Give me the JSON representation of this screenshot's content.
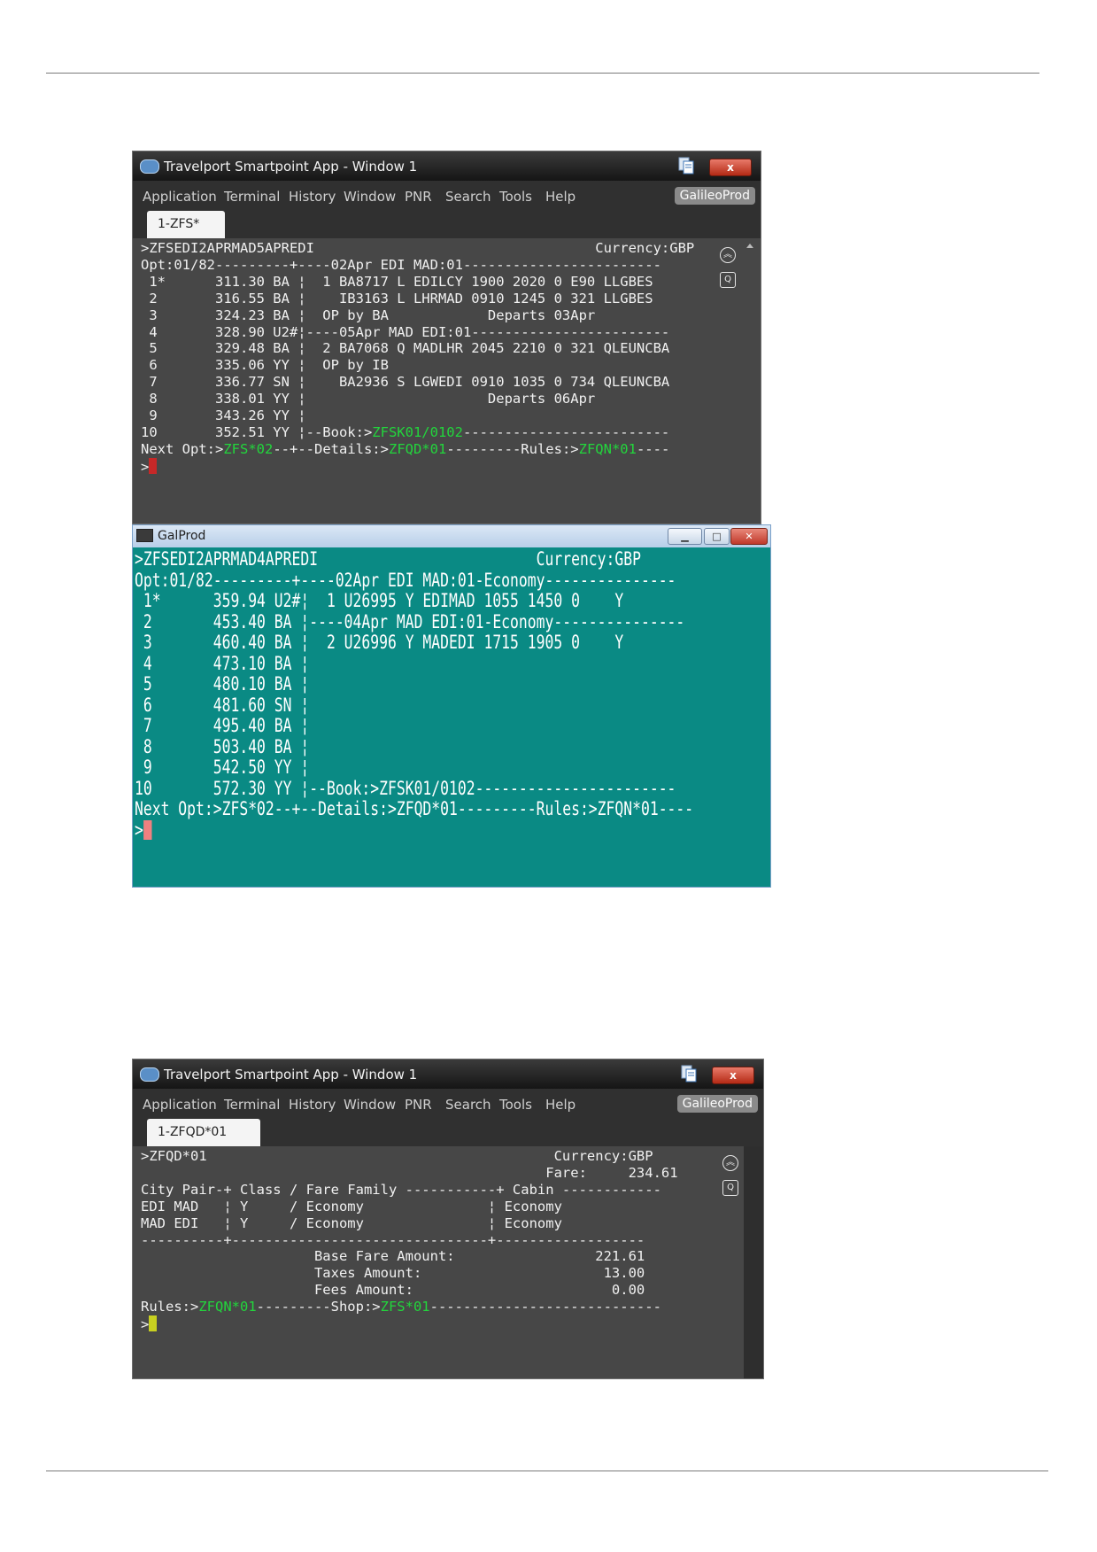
{
  "colors": {
    "smartpoint_screen": "#474747",
    "galprod_screen": "#0a8a84",
    "command_green": "#22d63c",
    "cursor_red": "#c62828",
    "cursor_salmon": "#f08080",
    "cursor_yellow": "#c8d020"
  },
  "window1": {
    "title": "Travelport Smartpoint App - Window 1",
    "close_label": "x",
    "menu": [
      "Application",
      "Terminal",
      "History",
      "Window",
      "PNR",
      "Search",
      "Tools",
      "Help"
    ],
    "env_badge": "GalileoProd",
    "tab": "1-ZFS*",
    "lines": [
      [
        {
          "t": ">ZFSEDI2APRMAD5APREDI                                  Currency:GBP"
        }
      ],
      [
        {
          "t": "Opt:01/82---------+----02Apr EDI MAD:01------------------------"
        }
      ],
      [
        {
          "t": " 1*      311.30 BA ¦  1 BA8717 L EDILCY 1900 2020 0 E90 LLGBES"
        }
      ],
      [
        {
          "t": " 2       316.55 BA ¦    IB3163 L LHRMAD 0910 1245 0 321 LLGBES"
        }
      ],
      [
        {
          "t": " 3       324.23 BA ¦  OP by BA            Departs 03Apr"
        }
      ],
      [
        {
          "t": " 4       328.90 U2#¦----05Apr MAD EDI:01------------------------"
        }
      ],
      [
        {
          "t": " 5       329.48 BA ¦  2 BA7068 Q MADLHR 2045 2210 0 321 QLEUNCBA"
        }
      ],
      [
        {
          "t": " 6       335.06 YY ¦  OP by IB"
        }
      ],
      [
        {
          "t": " 7       336.77 SN ¦    BA2936 S LGWEDI 0910 1035 0 734 QLEUNCBA"
        }
      ],
      [
        {
          "t": " 8       338.01 YY ¦                      Departs 06Apr"
        }
      ],
      [
        {
          "t": " 9       343.26 YY ¦"
        }
      ],
      [
        {
          "t": "10       352.51 YY ¦--Book:>"
        },
        {
          "t": "ZFSK01/0102",
          "g": true
        },
        {
          "t": "-------------------------"
        }
      ],
      [
        {
          "t": "Next Opt:>"
        },
        {
          "t": "ZFS*02",
          "g": true
        },
        {
          "t": "--+--Details:>"
        },
        {
          "t": "ZFQD*01",
          "g": true
        },
        {
          "t": "---------Rules:>"
        },
        {
          "t": "ZFQN*01",
          "g": true
        },
        {
          "t": "----"
        }
      ],
      [
        {
          "t": ">"
        }
      ]
    ]
  },
  "galprod": {
    "title": "GalProd",
    "lines": [
      ">ZFSEDI2APRMAD4APREDI                         Currency:GBP",
      "Opt:01/82---------+----02Apr EDI MAD:01-Economy---------------",
      " 1*      359.94 U2#¦  1 U26995 Y EDIMAD 1055 1450 0    Y",
      " 2       453.40 BA ¦----04Apr MAD EDI:01-Economy---------------",
      " 3       460.40 BA ¦  2 U26996 Y MADEDI 1715 1905 0    Y",
      " 4       473.10 BA ¦",
      " 5       480.10 BA ¦",
      " 6       481.60 SN ¦",
      " 7       495.40 BA ¦",
      " 8       503.40 BA ¦",
      " 9       542.50 YY ¦",
      "10       572.30 YY ¦--Book:>ZFSK01/0102-----------------------",
      "Next Opt:>ZFS*02--+--Details:>ZFQD*01---------Rules:>ZFQN*01----",
      ">"
    ]
  },
  "window2": {
    "title": "Travelport Smartpoint App - Window 1",
    "close_label": "x",
    "menu": [
      "Application",
      "Terminal",
      "History",
      "Window",
      "PNR",
      "Search",
      "Tools",
      "Help"
    ],
    "env_badge": "GalileoProd",
    "tab": "1-ZFQD*01",
    "lines": [
      [
        {
          "t": ">ZFQD*01                                          Currency:GBP"
        }
      ],
      [
        {
          "t": "                                                 Fare:     234.61"
        }
      ],
      [
        {
          "t": "City Pair-+ Class / Fare Family -----------+ Cabin ------------"
        }
      ],
      [
        {
          "t": "EDI MAD   ¦ Y     / Economy               ¦ Economy"
        }
      ],
      [
        {
          "t": "MAD EDI   ¦ Y     / Economy               ¦ Economy"
        }
      ],
      [
        {
          "t": "----------+-------------------------------+------------------"
        }
      ],
      [
        {
          "t": "                     Base Fare Amount:                 221.61"
        }
      ],
      [
        {
          "t": "                     Taxes Amount:                      13.00"
        }
      ],
      [
        {
          "t": "                     Fees Amount:                        0.00"
        }
      ],
      [
        {
          "t": "Rules:>"
        },
        {
          "t": "ZFQN*01",
          "g": true
        },
        {
          "t": "---------Shop:>"
        },
        {
          "t": "ZFS*01",
          "g": true
        },
        {
          "t": "----------------------------"
        }
      ],
      [
        {
          "t": ">"
        }
      ]
    ]
  }
}
